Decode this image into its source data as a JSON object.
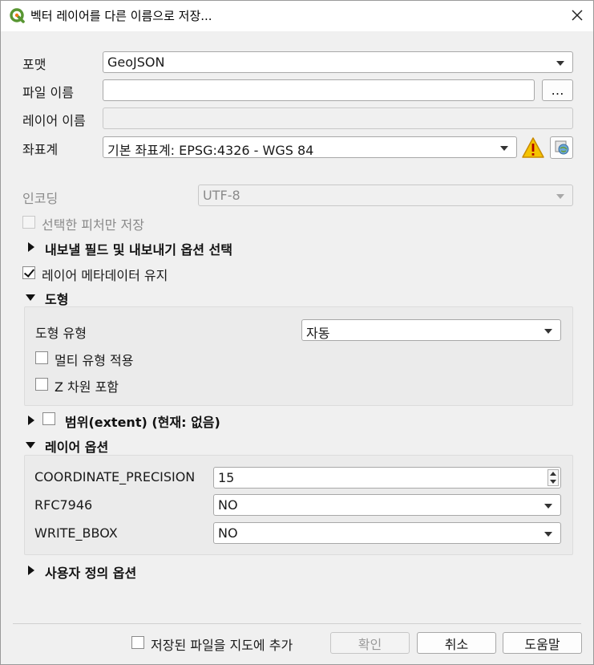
{
  "window": {
    "title": "벡터 레이어를 다른 이름으로 저장..."
  },
  "form": {
    "format_label": "포맷",
    "format_value": "GeoJSON",
    "filename_label": "파일 이름",
    "filename_value": "",
    "browse_label": "…",
    "layername_label": "레이어 이름",
    "layername_value": "",
    "crs_label": "좌표계",
    "crs_value": "기본 좌표계: EPSG:4326 - WGS 84",
    "encoding_label": "인코딩",
    "encoding_value": "UTF-8",
    "selected_only_label": "선택한 피처만 저장",
    "selected_only_checked": false,
    "fields_section_label": "내보낼 필드 및 내보내기 옵션 선택",
    "keep_metadata_label": "레이어 메타데이터 유지",
    "keep_metadata_checked": true
  },
  "geometry": {
    "section_label": "도형",
    "type_label": "도형 유형",
    "type_value": "자동",
    "multi_label": "멀티 유형 적용",
    "multi_checked": false,
    "z_label": "Z 차원 포함",
    "z_checked": false
  },
  "extent": {
    "section_label": "범위(extent) (현재: 없음)",
    "checked": false
  },
  "layer_options": {
    "section_label": "레이어 옵션",
    "rows": [
      {
        "label": "COORDINATE_PRECISION",
        "value": "15",
        "kind": "spin"
      },
      {
        "label": "RFC7946",
        "value": "NO",
        "kind": "combo"
      },
      {
        "label": "WRITE_BBOX",
        "value": "NO",
        "kind": "combo"
      }
    ]
  },
  "custom_options": {
    "section_label": "사용자 정의 옵션"
  },
  "footer": {
    "add_to_map_label": "저장된 파일을 지도에 추가",
    "add_to_map_checked": false,
    "ok_label": "확인",
    "cancel_label": "취소",
    "help_label": "도움말"
  },
  "colors": {
    "warning": "#f5c400",
    "qgis_green": "#589632",
    "qgis_yellow": "#ee7913"
  }
}
